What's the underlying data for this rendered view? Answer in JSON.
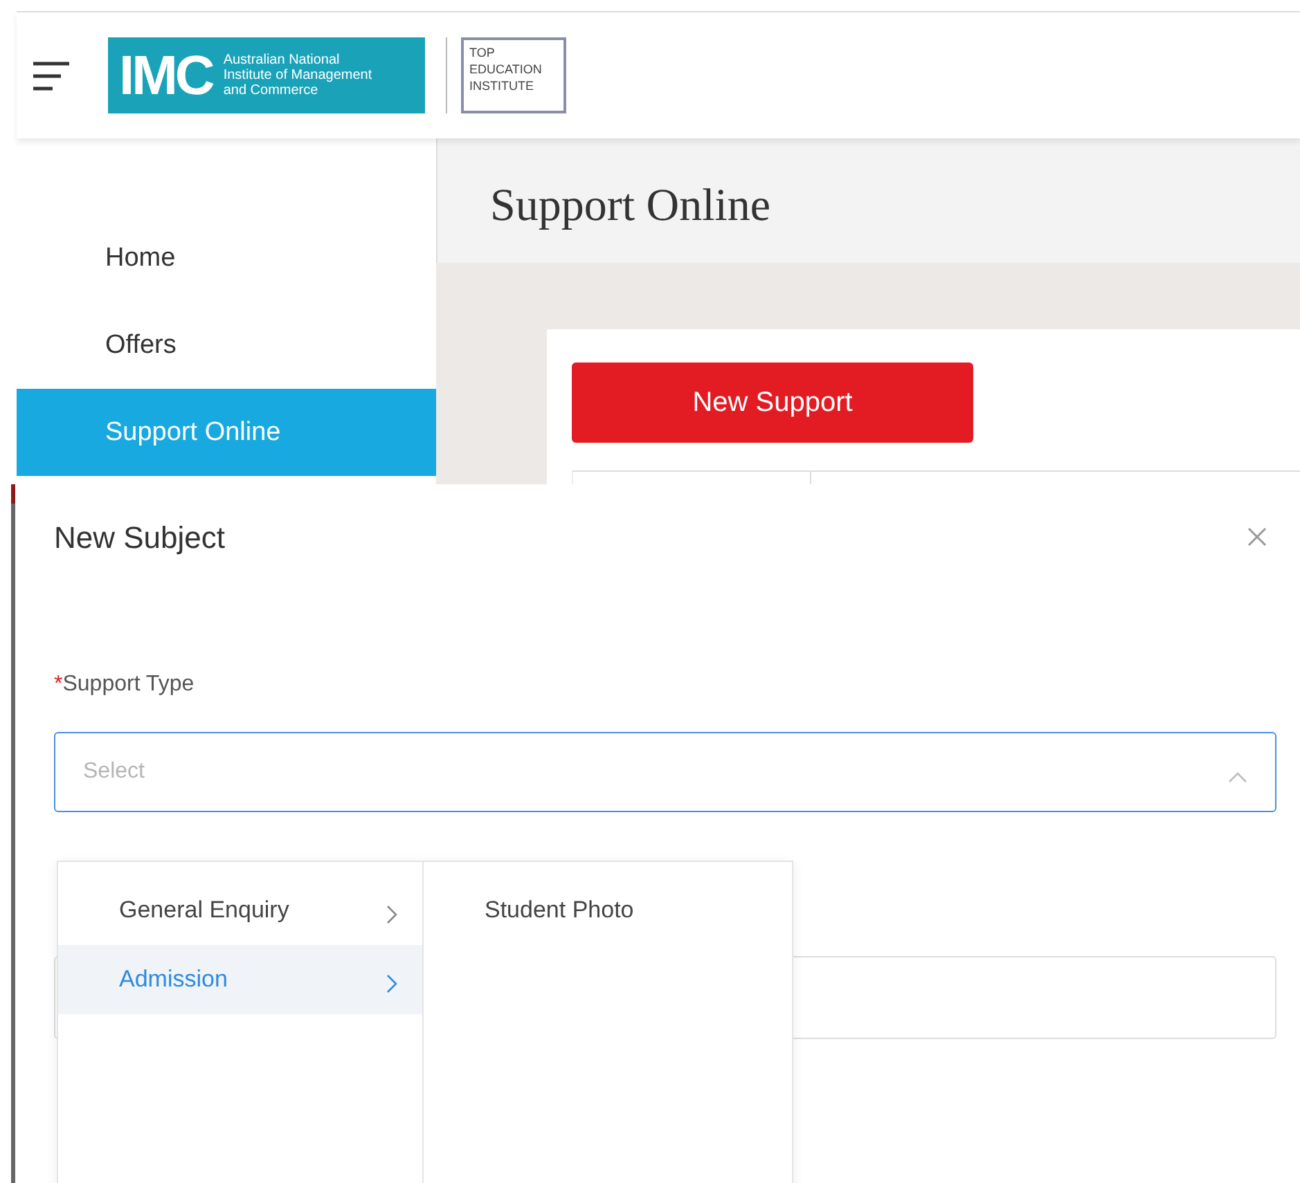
{
  "header": {
    "logo": {
      "mark": "IMC",
      "lines": [
        "Australian National",
        "Institute of Management",
        "and Commerce"
      ]
    },
    "partner_logo": [
      "TOP",
      "EDUCATION",
      "INSTITUTE"
    ]
  },
  "sidebar": {
    "items": [
      {
        "label": "Home",
        "selected": false
      },
      {
        "label": "Offers",
        "selected": false
      },
      {
        "label": "Support Online",
        "selected": true
      }
    ]
  },
  "page": {
    "title": "Support Online",
    "primary_button": "New Support"
  },
  "modal": {
    "title": "New Subject",
    "field": {
      "required_mark": "*",
      "label": "Support Type",
      "placeholder": "Select",
      "expanded": true
    },
    "cascader": {
      "columns": [
        [
          {
            "label": "General Enquiry",
            "selected": false,
            "has_children": true
          },
          {
            "label": "Admission",
            "selected": true,
            "has_children": true
          }
        ],
        [
          {
            "label": "Student Photo",
            "selected": false,
            "has_children": false
          }
        ]
      ]
    }
  }
}
